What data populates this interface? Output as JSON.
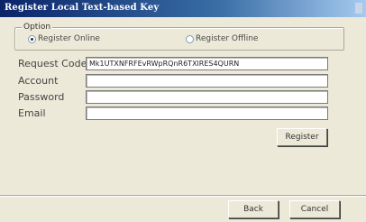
{
  "window": {
    "title": "Register Local Text-based Key"
  },
  "option": {
    "legend": "Option",
    "register_online": "Register Online",
    "register_offline": "Register Offline",
    "selected": "register_online"
  },
  "form": {
    "request_code_label": "Request Code",
    "request_code_value": "Mk1UTXNFRFEvRWpRQnR6TXlRES4QURN",
    "account_label": "Account",
    "account_value": "",
    "password_label": "Password",
    "password_value": "",
    "email_label": "Email",
    "email_value": ""
  },
  "buttons": {
    "register": "Register",
    "back": "Back",
    "cancel": "Cancel"
  }
}
